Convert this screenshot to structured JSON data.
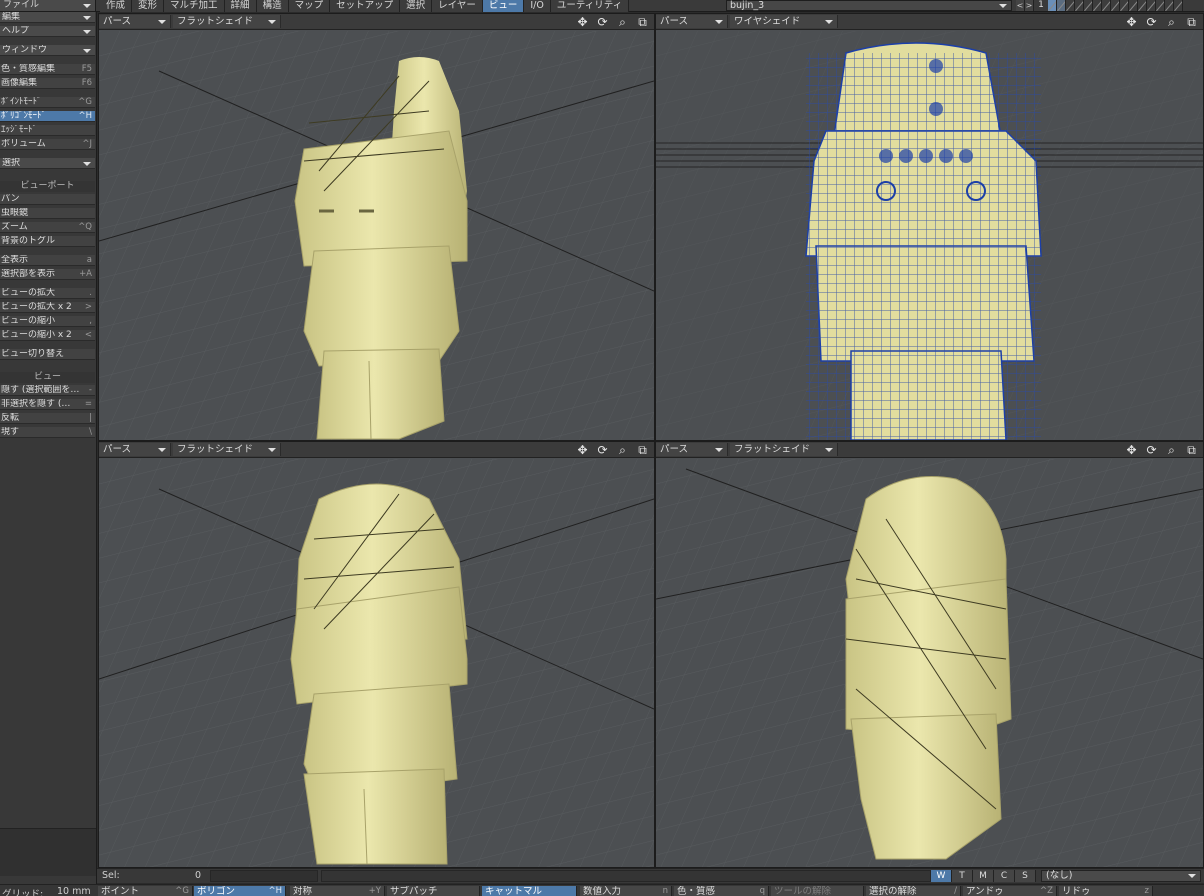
{
  "menu": {
    "file": "ファイル",
    "tabs": [
      "作成",
      "変形",
      "マルチ加工",
      "詳細",
      "構造",
      "マップ",
      "セットアップ",
      "選択",
      "レイヤー",
      "ビュー",
      "I/O",
      "ユーティリティ"
    ],
    "active_tab": "ビュー",
    "scene": "bujin_3",
    "layer_number": "1",
    "layer_prev": "<",
    "layer_next": ">"
  },
  "sidebar": {
    "edit": "編集",
    "help": "ヘルプ",
    "window": "ウィンドウ",
    "color_edit": {
      "label": "色・質感編集",
      "shortcut": "F5"
    },
    "image_edit": {
      "label": "画像編集",
      "shortcut": "F6"
    },
    "point_mode": {
      "label": "ﾎﾟｲﾝﾄﾓｰﾄﾞ",
      "shortcut": "^G"
    },
    "polygon_mode": {
      "label": "ﾎﾟﾘｺﾞﾝﾓｰﾄﾞ",
      "shortcut": "^H"
    },
    "edge_mode": {
      "label": "ｴｯｼﾞﾓｰﾄﾞ",
      "shortcut": ""
    },
    "volume": {
      "label": "ボリューム",
      "shortcut": "^J"
    },
    "select": "選択",
    "viewport_header": "ビューポート",
    "pan": {
      "label": "パン",
      "shortcut": ""
    },
    "magnifier": {
      "label": "虫眼鏡",
      "shortcut": ""
    },
    "zoom": {
      "label": "ズーム",
      "shortcut": "^Q"
    },
    "bg_toggle": {
      "label": "背景のトグル",
      "shortcut": ""
    },
    "fit_all": {
      "label": "全表示",
      "shortcut": "a"
    },
    "fit_selected": {
      "label": "選択部を表示",
      "shortcut": "+A"
    },
    "zoom_in": {
      "label": "ビューの拡大",
      "shortcut": "."
    },
    "zoom_in2": {
      "label": "ビューの拡大 x 2",
      "shortcut": ">"
    },
    "zoom_out": {
      "label": "ビューの縮小",
      "shortcut": ","
    },
    "zoom_out2": {
      "label": "ビューの縮小 x 2",
      "shortcut": "<"
    },
    "view_switch": {
      "label": "ビュー切り替え",
      "shortcut": ""
    },
    "view_header": "ビュー",
    "hide_sel": {
      "label": "隠す (選択範囲を…",
      "shortcut": "-"
    },
    "hide_unsel": {
      "label": "非選択を隠す (…",
      "shortcut": "="
    },
    "invert": {
      "label": "反転",
      "shortcut": "|"
    },
    "show": {
      "label": "現す",
      "shortcut": "\\"
    }
  },
  "viewports": {
    "top_left": {
      "view": "パース",
      "shading": "フラットシェイド"
    },
    "top_right": {
      "view": "パース",
      "shading": "ワイヤシェイド"
    },
    "bottom_left": {
      "view": "パース",
      "shading": "フラットシェイド"
    },
    "bottom_right": {
      "view": "パース",
      "shading": "フラットシェイド"
    },
    "icons": [
      "move-view-icon",
      "rotate-view-icon",
      "zoom-view-icon",
      "maximize-view-icon"
    ]
  },
  "status": {
    "sel_label": "Sel:",
    "sel_count": "0",
    "view_buttons": [
      "W",
      "T",
      "M",
      "C",
      "S"
    ],
    "active_view_button": "W",
    "surface": "(なし)"
  },
  "bottom": {
    "grid_label": "グリッド:",
    "grid_value": "10 mm",
    "buttons": [
      {
        "label": "ポイント",
        "shortcut": "^G"
      },
      {
        "label": "ポリゴン",
        "shortcut": "^H"
      },
      {
        "label": "対称",
        "shortcut": "+Y"
      },
      {
        "label": "サブパッチ",
        "shortcut": ""
      },
      {
        "label": "キャットマル",
        "shortcut": ""
      },
      {
        "label": "数値入力",
        "shortcut": "n"
      },
      {
        "label": "色・質感",
        "shortcut": "q"
      },
      {
        "label": "ツールの解除",
        "shortcut": ""
      },
      {
        "label": "選択の解除",
        "shortcut": "/"
      },
      {
        "label": "アンドゥ",
        "shortcut": "^Z"
      },
      {
        "label": "リドゥ",
        "shortcut": "z"
      }
    ]
  },
  "colors": {
    "accent": "#4d79a8",
    "model": "#e2dd9e",
    "wire": "#1c3fa8",
    "viewport_bg": "#4c4f52"
  }
}
